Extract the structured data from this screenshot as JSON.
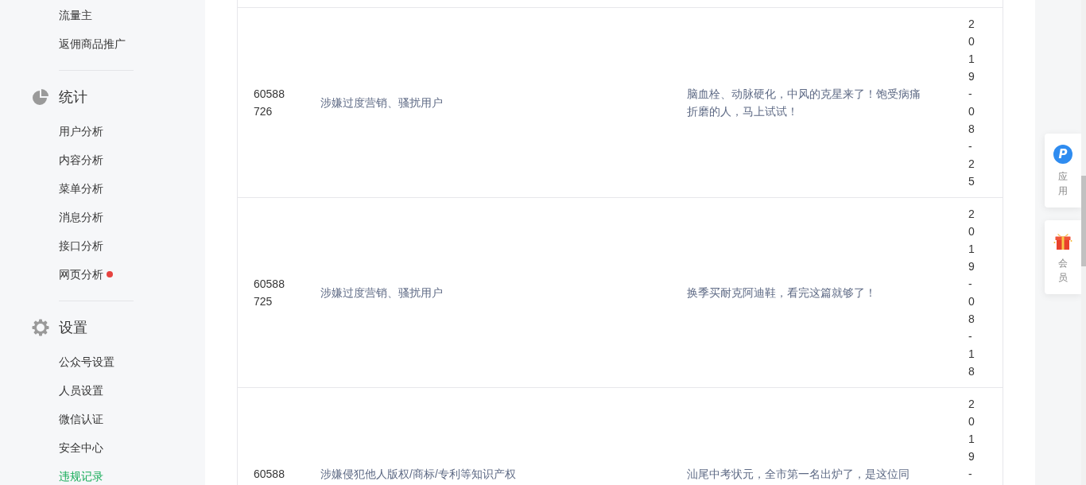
{
  "sidebar": {
    "groups": [
      {
        "items": [
          {
            "label": "流量主",
            "selected": false,
            "dot": false
          },
          {
            "label": "返佣商品推广",
            "selected": false,
            "dot": false
          }
        ]
      },
      {
        "kind": "stats",
        "title": "统计",
        "items": [
          {
            "label": "用户分析",
            "selected": false,
            "dot": false
          },
          {
            "label": "内容分析",
            "selected": false,
            "dot": false
          },
          {
            "label": "菜单分析",
            "selected": false,
            "dot": false
          },
          {
            "label": "消息分析",
            "selected": false,
            "dot": false
          },
          {
            "label": "接口分析",
            "selected": false,
            "dot": false
          },
          {
            "label": "网页分析",
            "selected": false,
            "dot": true
          }
        ]
      },
      {
        "kind": "settings",
        "title": "设置",
        "items": [
          {
            "label": "公众号设置",
            "selected": false,
            "dot": false
          },
          {
            "label": "人员设置",
            "selected": false,
            "dot": false
          },
          {
            "label": "微信认证",
            "selected": false,
            "dot": false
          },
          {
            "label": "安全中心",
            "selected": false,
            "dot": false
          },
          {
            "label": "违规记录",
            "selected": true,
            "dot": false
          }
        ]
      }
    ]
  },
  "table": {
    "rows": [
      {
        "cells": [
          "60588726",
          "涉嫌过度营销、骚扰用户",
          "脑血栓、动脉硬化，中风的克星来了！饱受病痛折磨的人，马上试试！",
          "2019-08-25"
        ]
      },
      {
        "cells": [
          "60588725",
          "涉嫌过度营销、骚扰用户",
          "换季买耐克阿迪鞋，看完这篇就够了！",
          "2019-08-18"
        ]
      },
      {
        "cells": [
          "60588",
          "涉嫌侵犯他人版权/商标/专利等知识产权",
          "汕尾中考状元，全市第一名出炉了，是这位同",
          "2019-"
        ]
      }
    ]
  },
  "side_panel": {
    "items": [
      {
        "kind": "app",
        "icon_text": "P",
        "label": "应用"
      },
      {
        "kind": "member",
        "label": "会员"
      }
    ]
  }
}
